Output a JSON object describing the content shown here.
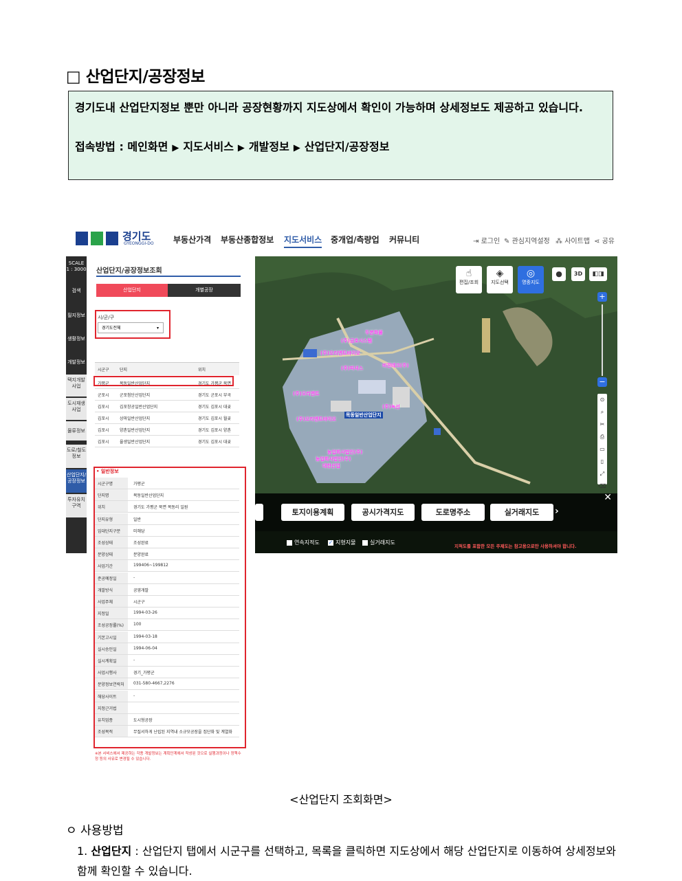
{
  "heading": "□ 산업단지/공장정보",
  "intro": {
    "line1": "경기도내 산업단지정보 뿐만 아니라 공장현황까지 지도상에서 확인이 가능하며 상세정보도 제공하고 있습니다.",
    "access_label": "접속방법 : 메인화면",
    "path": [
      "지도서비스",
      "개발정보",
      "산업단지/공장정보"
    ],
    "arrow": "▶"
  },
  "screenshot": {
    "logo": {
      "text": "경기도",
      "sub": "GYEONGGI-DO",
      "colors": [
        "#1a3f8f",
        "#2aa34a"
      ]
    },
    "nav": [
      "부동산가격",
      "부동산종합정보",
      "지도서비스",
      "중개업/측량업",
      "커뮤니티"
    ],
    "utils": [
      "로그인",
      "관심지역설정",
      "사이트맵",
      "공유"
    ],
    "scale": {
      "label": "SCALE",
      "value": "1 : 3000"
    },
    "strip": [
      "검색",
      "필지정보",
      "생활정보",
      "개발정보",
      "택지개발 사업",
      "도시재생 사업",
      "물류정보",
      "도로/철도 정보",
      "산업단지/ 공장정보",
      "투자유치 구역"
    ],
    "panel": {
      "title": "산업단지/공장정보조회",
      "tabs": [
        "산업단지",
        "개별공장"
      ],
      "region_label": "시/군/구",
      "region_value": "경기도전체",
      "table_headers": [
        "시군구",
        "단지",
        "위치"
      ],
      "rows": [
        [
          "가평군",
          "목동일반산업단지",
          "경기도 가평군 북면"
        ],
        [
          "군포시",
          "군포첨단산업단지",
          "경기도 군포시 부곡"
        ],
        [
          "김포시",
          "김포창공일반산업단지",
          "경기도 김포시 대곶"
        ],
        [
          "김포시",
          "상마일반산업단지",
          "경기도 김포시 월곶"
        ],
        [
          "김포시",
          "양촌일반산업단지",
          "경기도 김포시 양촌"
        ],
        [
          "김포시",
          "율생일반산업단지",
          "경기도 김포시 대곶"
        ]
      ],
      "info_title": "일반정보",
      "info": [
        [
          "시군구명",
          "가평군"
        ],
        [
          "단지명",
          "목동일반산업단지"
        ],
        [
          "위치",
          "경기도 가평군 북면 목동리 일원"
        ],
        [
          "단지유형",
          "일반"
        ],
        [
          "임대단지구분",
          "미해당"
        ],
        [
          "조성상태",
          "조성완료"
        ],
        [
          "분양상태",
          "분양완료"
        ],
        [
          "사업기간",
          "199406~199812"
        ],
        [
          "준공예정일",
          "-"
        ],
        [
          "개발방식",
          "공영개발"
        ],
        [
          "사업주체",
          "시군구"
        ],
        [
          "지정일",
          "1994-03-26"
        ],
        [
          "조성공정률(%)",
          "100"
        ],
        [
          "기본고시일",
          "1994-03-18"
        ],
        [
          "실시승인일",
          "1994-06-04"
        ],
        [
          "실시계획일",
          "-"
        ],
        [
          "사업시행사",
          "경기_가평군"
        ],
        [
          "분양정보연락처",
          "031-580-4667,2276"
        ],
        [
          "해당사이트",
          "-"
        ],
        [
          "지정근거법",
          ""
        ],
        [
          "유치업종",
          "도시형공장"
        ],
        [
          "조성목적",
          "무질서하게 난립된 지역내 소규모공장을 집단화 및 계열화"
        ]
      ],
      "notice": "※본 서비스에서 제공하는 각종 개발정보는 계획단계에서 작성된 것으로 실행과정이나 정책수정 등의 사유로 변경될 수 있습니다."
    },
    "map": {
      "buttons": [
        "편집/조회",
        "지도선택",
        "명종지도"
      ],
      "labels": [
        "두본화물",
        "(주)금호시스템",
        "(주)오리엔트바이오",
        "(주)피셔스",
        "(주)오리엔트",
        "비젼테크(주)",
        "목동일반산업단지",
        "(주)오리엔트바이오",
        "(주)녹선",
        "농업회사법인(주)",
        "농업회사법인(주)",
        "대한산업"
      ],
      "quick": [
        "토지이용계획",
        "공시가격지도",
        "도로명주소",
        "실거래지도"
      ],
      "checks": [
        [
          "연속지적도",
          false
        ],
        [
          "지형지물",
          true
        ],
        [
          "실거래지도",
          false
        ]
      ],
      "warning": "지적도를 포함한 모든 주제도는 참고용으로만 사용하셔야 합니다."
    }
  },
  "caption": "<산업단지 조회화면>",
  "usage": {
    "heading": "ㅇ 사용방법",
    "item_num": "1.",
    "item_bold": "산업단지",
    "item_text": " : 산업단지 탭에서 시군구를 선택하고, 목록을 클릭하면 지도상에서 해당 산업단지로 이동하여 상세정보와 함께 확인할 수 있습니다."
  }
}
